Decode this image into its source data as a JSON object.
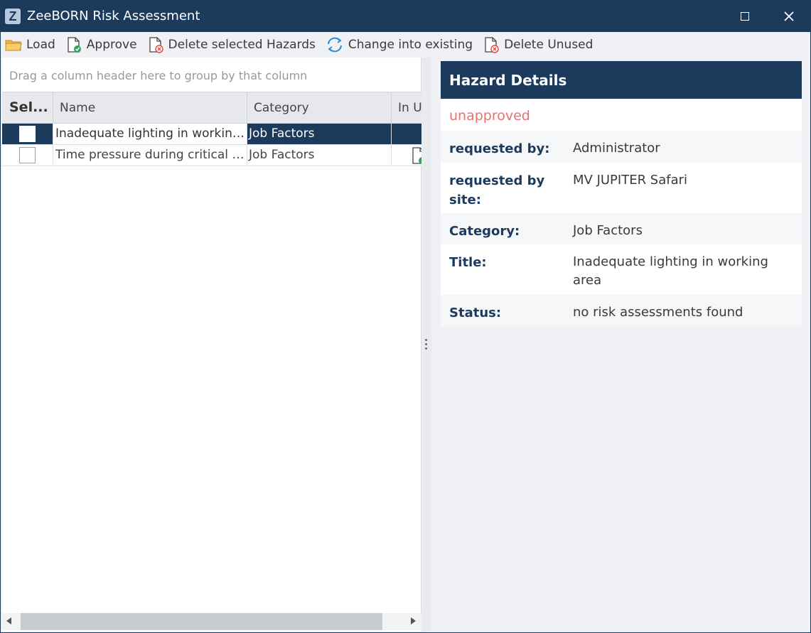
{
  "window": {
    "icon_letter": "Z",
    "title": "ZeeBORN Risk Assessment"
  },
  "toolbar": {
    "load": "Load",
    "approve": "Approve",
    "delete_selected": "Delete selected Hazards",
    "change_existing": "Change into existing",
    "delete_unused": "Delete Unused"
  },
  "grid": {
    "group_hint": "Drag a column header here to group by that column",
    "columns": [
      "Sel...",
      "Name",
      "Category",
      "In Use"
    ],
    "rows": [
      {
        "name": "Inadequate lighting in working ...",
        "category": "Job Factors",
        "selected": true
      },
      {
        "name": "Time pressure during critical op...",
        "category": "Job Factors",
        "selected": false
      }
    ]
  },
  "details": {
    "header": "Hazard Details",
    "status_text": "unapproved",
    "fields": [
      {
        "label": "requested by:",
        "value": "Administrator"
      },
      {
        "label": "requested by site:",
        "value": "MV JUPITER Safari"
      },
      {
        "label": "Category:",
        "value": "Job Factors"
      },
      {
        "label": "Title:",
        "value": "Inadequate lighting in working area"
      },
      {
        "label": "Status:",
        "value": "no risk assessments found"
      }
    ]
  },
  "colors": {
    "accent": "#1b3a5c",
    "unapproved": "#e9706c"
  }
}
